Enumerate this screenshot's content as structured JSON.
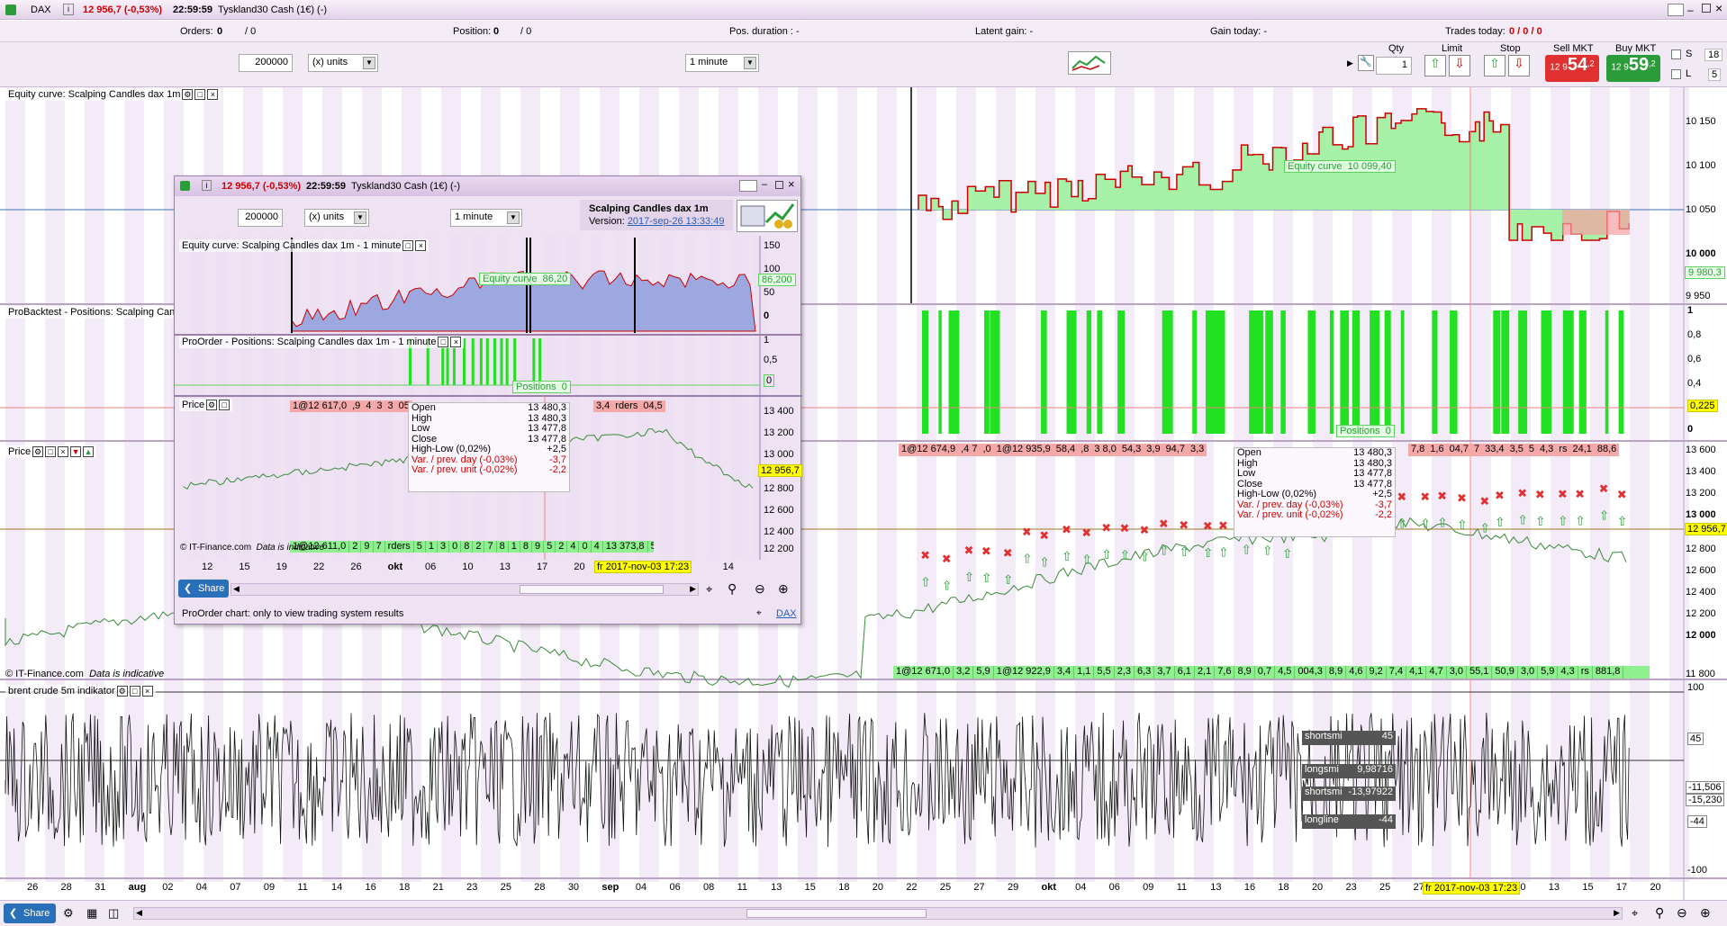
{
  "window": {
    "instrument": "DAX",
    "price": "12 956,7 (-0,53%)",
    "time": "22:59:59",
    "name": "Tyskland30 Cash (1€) (-)"
  },
  "info": {
    "orders_label": "Orders:",
    "orders_value": "0",
    "orders_value2": "/ 0",
    "position_label": "Position:",
    "position_value": "0",
    "position_value2": "/ 0",
    "pos_duration": "Pos. duration : -",
    "latent_gain": "Latent gain: -",
    "gain_today": "Gain today: -",
    "trades_today_label": "Trades today:",
    "trades_today_value": "0 / 0 / 0"
  },
  "toolbar": {
    "units_value": "200000",
    "units_select": "(x) units",
    "timeframe": "1 minute",
    "qty_label": "Qty",
    "qty_value": "1",
    "limit_label": "Limit",
    "stop_label": "Stop",
    "sell_label": "Sell MKT",
    "buy_label": "Buy MKT",
    "sell_price_small": "12 9",
    "sell_price_big": "54",
    "sell_price_sup": ",2",
    "buy_price_small": "12 9",
    "buy_price_big": "59",
    "buy_price_sup": ",2",
    "s_label": "S",
    "l_label": "L",
    "s_count": "18",
    "l_count": "5"
  },
  "main": {
    "equity_title": "Equity curve: Scalping Candles dax 1m",
    "probacktest_title": "ProBacktest - Positions: Scalping Cand",
    "price_title": "Price",
    "brent_title": "brent crude 5m indikator",
    "equity_legend": "Equity curve",
    "equity_legend_value": "10 099,40",
    "equity_current": "9 980,3",
    "equity_yaxis": [
      "10 150",
      "10 100",
      "10 050",
      "10 000",
      "9 950"
    ],
    "pos_yaxis": [
      "1",
      "0,8",
      "0,6",
      "0,4",
      "0,225",
      "0"
    ],
    "pos_legend": "Positions",
    "pos_legend_value": "0",
    "price_yaxis": [
      "13 600",
      "13 400",
      "13 200",
      "13 000",
      "12 800",
      "12 600",
      "12 400",
      "12 200",
      "12 000",
      "11 800"
    ],
    "price_current": "12 956,7",
    "ind_yaxis": [
      "100",
      "45",
      "-11,506",
      "-15,230",
      "-44",
      "-100"
    ],
    "copyright": "© IT-Finance.com",
    "indicative": "Data is indicative",
    "date_tooltip": "fr 2017-nov-03 17:23",
    "orders_top": [
      "1@12 674,9",
      ",4 7",
      ",0",
      "1@12 935,9",
      "58,4",
      ",8",
      "3 8,0",
      "54,3",
      "3,9",
      "94,7",
      "3,3"
    ],
    "orders_top_right": [
      "7,8",
      "1,6",
      "04,7",
      "7",
      "33,4",
      "3,5",
      "5",
      "4,3",
      "rs",
      "24,1",
      "88,6"
    ],
    "orders_bottom": [
      "1@12 671,0",
      "3,2",
      "5,9",
      "1@12 922,9",
      "3,4",
      "1,1",
      "5,5",
      "2,3",
      "6,3",
      "3,7",
      "6,1",
      "2,1",
      "7,6",
      "8,9",
      "0,7",
      "4,5",
      "004,3",
      "8,9",
      "4,6",
      "9,2",
      "7,4",
      "4,1",
      "4,7",
      "3,0",
      "55,1",
      "50,9",
      "3,0",
      "5,9",
      "4,3",
      "rs",
      "881,8"
    ],
    "xaxis": [
      "26",
      "28",
      "31",
      "aug",
      "02",
      "04",
      "07",
      "09",
      "11",
      "14",
      "16",
      "18",
      "21",
      "23",
      "25",
      "28",
      "30",
      "sep",
      "04",
      "06",
      "08",
      "11",
      "13",
      "15",
      "18",
      "20",
      "22",
      "25",
      "27",
      "29",
      "okt",
      "04",
      "06",
      "09",
      "11",
      "13",
      "16",
      "18",
      "20",
      "23",
      "25",
      "27",
      "30",
      "nov",
      "10",
      "13",
      "15",
      "17",
      "20"
    ],
    "ohlc": {
      "open_l": "Open",
      "open_v": "13 480,3",
      "high_l": "High",
      "high_v": "13 480,3",
      "low_l": "Low",
      "low_v": "13 477,8",
      "close_l": "Close",
      "close_v": "13 477,8",
      "hl_l": "High-Low (0,02%)",
      "hl_v": "+2,5",
      "var_day_l": "Var. / prev. day (-0,03%)",
      "var_day_v": "-3,7",
      "var_unit_l": "Var. / prev. unit (-0,02%)",
      "var_unit_v": "-2,2"
    },
    "ind_labels": [
      {
        "name": "shortsmi",
        "value": "45"
      },
      {
        "name": "longsmi",
        "value": "9,98716"
      },
      {
        "name": "shortsmi",
        "value": "-13,97922"
      },
      {
        "name": "longline",
        "value": "-44"
      }
    ],
    "share": "Share"
  },
  "popup": {
    "price": "12 956,7 (-0,53%)",
    "time": "22:59:59",
    "name": "Tyskland30 Cash (1€) (-)",
    "units_value": "200000",
    "units_select": "(x) units",
    "timeframe": "1 minute",
    "system_name": "Scalping Candles dax 1m",
    "version_label": "Version:",
    "version_link": "2017-sep-26 13:33:49",
    "equity_title": "Equity curve: Scalping Candles dax 1m - 1 minute",
    "positions_title": "ProOrder - Positions: Scalping Candles dax 1m - 1 minute",
    "price_title": "Price",
    "equity_yaxis": [
      "150",
      "100",
      "50",
      "0"
    ],
    "equity_legend": "Equity curve",
    "equity_legend_value": "86,20",
    "equity_current": "86,200",
    "pos_yaxis": [
      "1",
      "0,5",
      "0"
    ],
    "pos_legend": "Positions",
    "pos_legend_value": "0",
    "price_yaxis": [
      "13 400",
      "13 200",
      "13 000",
      "12 800",
      "12 600",
      "12 400",
      "12 200"
    ],
    "price_current": "12 956,7",
    "orders_top": [
      "1@12 617,0",
      ",9",
      "4",
      "3",
      "3",
      "05"
    ],
    "orders_top_right": [
      "3,4",
      "rders",
      "04,5"
    ],
    "orders_bottom": [
      "1@12 611,0",
      "2",
      "9",
      "7",
      "rders",
      "5",
      "1",
      "3",
      "0",
      "8",
      "2",
      "7",
      "8",
      "1",
      "8",
      "9",
      "5",
      "2",
      "4",
      "0",
      "4",
      "13 373,8",
      "5"
    ],
    "xaxis": [
      "12",
      "15",
      "19",
      "22",
      "26",
      "okt",
      "06",
      "10",
      "13",
      "17",
      "20",
      "24",
      "27",
      "0",
      "14"
    ],
    "date_tooltip": "fr 2017-nov-03 17:23",
    "copyright": "© IT-Finance.com",
    "indicative": "Data is indicative",
    "share": "Share",
    "footer": "ProOrder chart: only to view trading system results",
    "dax_link": "DAX"
  },
  "colors": {
    "buy_green": "#2c9c3a",
    "sell_red": "#e03030",
    "equity_fill": "#a7f0a7",
    "equity_line": "#cc0000",
    "position_bar": "#22e022",
    "bg_lavender": "#f5eef8"
  }
}
